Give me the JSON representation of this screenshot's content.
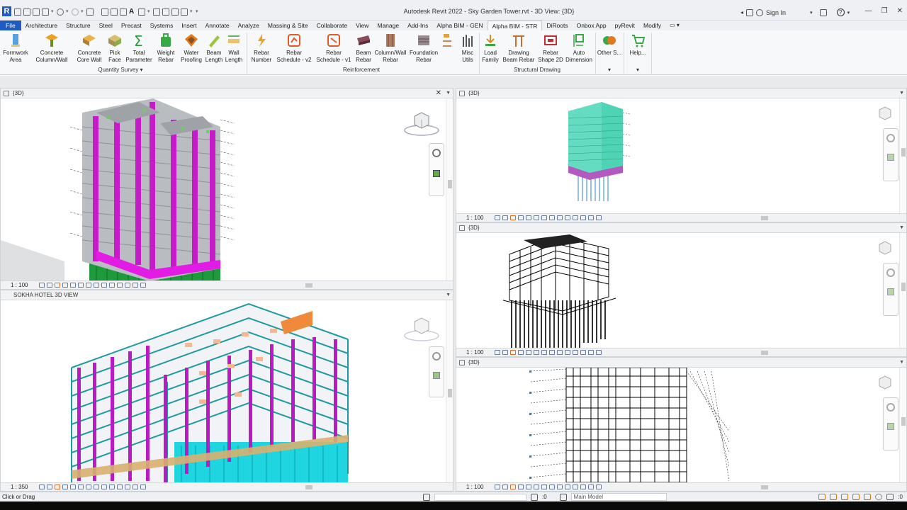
{
  "app": {
    "logo_letter": "R",
    "window_title": "Autodesk Revit 2022 - Sky Garden Tower.rvt - 3D View: {3D}",
    "sign_in": "Sign In",
    "help": "?",
    "window_controls": [
      "—",
      "❐",
      "✕"
    ]
  },
  "tabs": [
    "File",
    "Architecture",
    "Structure",
    "Steel",
    "Precast",
    "Systems",
    "Insert",
    "Annotate",
    "Analyze",
    "Massing & Site",
    "Collaborate",
    "View",
    "Manage",
    "Add-Ins",
    "Alpha BIM - GEN",
    "Alpha BIM - STR",
    "DiRoots",
    "Onbox App",
    "pyRevit",
    "Modify"
  ],
  "active_tab": "Alpha BIM - STR",
  "ribbon": {
    "quantity_survey": {
      "label": "Quantity Survey",
      "buttons": [
        {
          "line1": "Formwork",
          "line2": "Area"
        },
        {
          "line1": "Concrete",
          "line2": "Column/Wall"
        },
        {
          "line1": "Concrete",
          "line2": "Core Wall"
        },
        {
          "line1": "Pick",
          "line2": "Face"
        },
        {
          "line1": "Total",
          "line2": "Parameter"
        },
        {
          "line1": "Weight",
          "line2": "Rebar"
        },
        {
          "line1": "Water",
          "line2": "Proofing"
        },
        {
          "line1": "Beam",
          "line2": "Length"
        },
        {
          "line1": "Wall",
          "line2": "Length"
        }
      ]
    },
    "reinforcement": {
      "label": "Reinforcement",
      "buttons": [
        {
          "line1": "Rebar",
          "line2": "Number"
        },
        {
          "line1": "Rebar",
          "line2": "Schedule - v2"
        },
        {
          "line1": "Rebar",
          "line2": "Schedule - v1"
        },
        {
          "line1": "Beam",
          "line2": "Rebar"
        },
        {
          "line1": "Column/Wall",
          "line2": "Rebar"
        },
        {
          "line1": "Foundation",
          "line2": "Rebar"
        },
        {
          "line1": "Misc",
          "line2": "Utils"
        }
      ]
    },
    "structural_drawing": {
      "label": "Structural Drawing",
      "buttons": [
        {
          "line1": "Load",
          "line2": "Family"
        },
        {
          "line1": "Drawing",
          "line2": "Beam Rebar"
        },
        {
          "line1": "Rebar",
          "line2": "Shape 2D"
        },
        {
          "line1": "Auto",
          "line2": "Dimension"
        }
      ]
    },
    "other": {
      "line1": "Other S...",
      "line2": ""
    },
    "help": {
      "line1": "Help...",
      "line2": ""
    }
  },
  "views": [
    {
      "title": "{3D}",
      "scale": "1 : 100",
      "closable": true
    },
    {
      "title": "SOKHA HOTEL 3D VIEW",
      "scale": "1 : 350",
      "closable": false
    },
    {
      "title": "{3D}",
      "scale": "1 : 100",
      "closable": false
    },
    {
      "title": "{3D}",
      "scale": "1 : 100",
      "closable": false
    },
    {
      "title": "{3D}",
      "scale": "1 : 100",
      "closable": false
    }
  ],
  "status": {
    "hint": "Click or Drag",
    "zero": ":0",
    "workset": "Main Model",
    "filter_count": ":0"
  },
  "colors": {
    "file_tab": "#1f5bc0",
    "column_magenta": "#c51bc8",
    "slab_grey": "#b9bcc0",
    "pile_green": "#1e9a3c",
    "pile_cyan": "#1fd6e0",
    "tower_teal": "#4fd3b5",
    "beam_orange": "#f08a3a"
  },
  "icons": [
    "revit-logo",
    "open-icon",
    "save-icon",
    "undo-icon",
    "redo-icon",
    "print-icon",
    "measure-icon",
    "text-icon",
    "3d-icon",
    "signin-icon",
    "cart-icon",
    "help-icon",
    "viewcube-icon",
    "steering-wheel-icon",
    "zoom-icon"
  ]
}
